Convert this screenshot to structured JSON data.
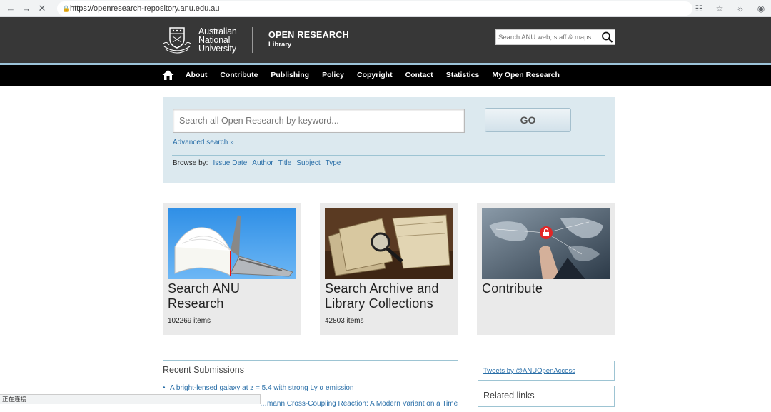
{
  "browser": {
    "url": "https://openresearch-repository.anu.edu.au",
    "back_icon": "arrow-left-icon",
    "forward_icon": "arrow-right-icon",
    "stop_icon": "close-icon",
    "status_text": "正在连接..."
  },
  "header": {
    "university_line1": "Australian",
    "university_line2": "National",
    "university_line3": "University",
    "site_title": "OPEN RESEARCH",
    "site_subtitle": "Library",
    "search_placeholder": "Search ANU web, staff & maps"
  },
  "nav": {
    "items": [
      "About",
      "Contribute",
      "Publishing",
      "Policy",
      "Copyright",
      "Contact",
      "Statistics",
      "My Open Research"
    ]
  },
  "search": {
    "placeholder": "Search all Open Research by keyword...",
    "go_label": "GO",
    "advanced_label": "Advanced search »",
    "browse_label": "Browse by:",
    "browse_options": [
      "Issue Date",
      "Author",
      "Title",
      "Subject",
      "Type"
    ]
  },
  "cards": [
    {
      "title": "Search ANU Research",
      "count": "102269 items"
    },
    {
      "title": "Search Archive and Library Collections",
      "count": "42803 items"
    },
    {
      "title": "Contribute",
      "count": ""
    }
  ],
  "recent": {
    "title": "Recent Submissions",
    "items": [
      "A bright-lensed galaxy at z = 5.4 with strong Ly α emission",
      "…mann Cross-Coupling Reaction: A Modern Variant on a Time-"
    ]
  },
  "sidebar": {
    "tweets_label": "Tweets by @ANUOpenAccess",
    "related_label": "Related links"
  },
  "colors": {
    "header_bg": "#373737",
    "nav_bg": "#000000",
    "panel_bg": "#dce9ef",
    "link": "#2a6fa8",
    "card_bg": "#eaeaea"
  }
}
